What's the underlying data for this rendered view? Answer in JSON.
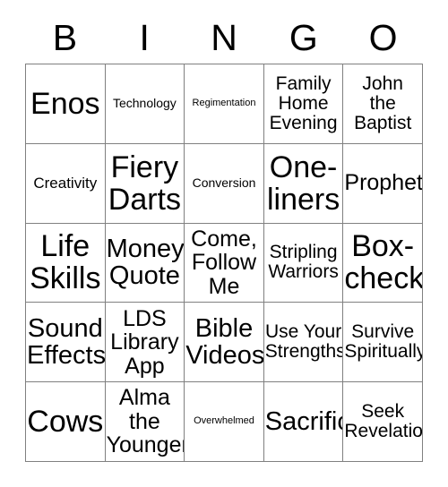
{
  "card": {
    "header_letters": [
      "B",
      "I",
      "N",
      "G",
      "O"
    ],
    "border_color": "#808080",
    "text_color": "#000000",
    "background_color": "#ffffff",
    "rows": 5,
    "columns": 5,
    "cells": [
      {
        "label": "Enos",
        "size": "xxl"
      },
      {
        "label": "Technology",
        "size": "xs"
      },
      {
        "label": "Regimentation",
        "size": "xxs"
      },
      {
        "label": "Family\nHome\nEvening",
        "size": "md"
      },
      {
        "label": "John\nthe\nBaptist",
        "size": "md"
      },
      {
        "label": "Creativity",
        "size": "sm"
      },
      {
        "label": "Fiery\nDarts",
        "size": "xxl"
      },
      {
        "label": "Conversion",
        "size": "xs"
      },
      {
        "label": "One-\nliners",
        "size": "xxl"
      },
      {
        "label": "Prophet",
        "size": "lg"
      },
      {
        "label": "Life\nSkills",
        "size": "xxl"
      },
      {
        "label": "Money\nQuote",
        "size": "xl"
      },
      {
        "label": "Come,\nFollow\nMe",
        "size": "lg"
      },
      {
        "label": "Stripling\nWarriors",
        "size": "md"
      },
      {
        "label": "Box-\ncheck",
        "size": "xxl"
      },
      {
        "label": "Sound\nEffects",
        "size": "xl"
      },
      {
        "label": "LDS\nLibrary\nApp",
        "size": "lg"
      },
      {
        "label": "Bible\nVideos",
        "size": "xl"
      },
      {
        "label": "Use Your\nStrengths",
        "size": "md"
      },
      {
        "label": "Survive\nSpiritually",
        "size": "md"
      },
      {
        "label": "Cows",
        "size": "xxl"
      },
      {
        "label": "Alma\nthe\nYounger",
        "size": "lg"
      },
      {
        "label": "Overwhelmed",
        "size": "xxs"
      },
      {
        "label": "Sacrifice",
        "size": "xl"
      },
      {
        "label": "Seek\nRevelation",
        "size": "md"
      }
    ]
  }
}
